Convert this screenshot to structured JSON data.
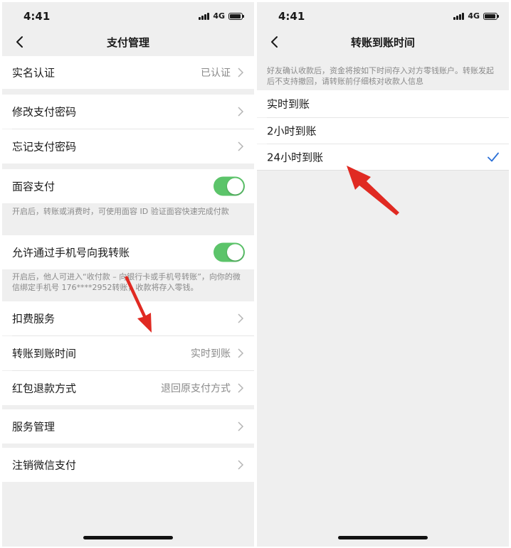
{
  "colors": {
    "page_bg": "#efefef",
    "toggle_on": "#5cc46a",
    "check": "#2c70d7",
    "arrow": "#e02a22"
  },
  "left": {
    "status": {
      "time": "4:41",
      "network": "4G"
    },
    "title": "支付管理",
    "real_name": {
      "label": "实名认证",
      "value": "已认证"
    },
    "change_pwd": {
      "label": "修改支付密码"
    },
    "forget_pwd": {
      "label": "忘记支付密码"
    },
    "face_pay": {
      "label": "面容支付",
      "enabled": true,
      "note": "开启后，转账或消费时，可使用面容 ID 验证面容快速完成付款"
    },
    "phone_transfer": {
      "label": "允许通过手机号向我转账",
      "enabled": true,
      "note": "开启后，他人可进入“收付款 – 向银行卡或手机号转账”，向你的微信绑定手机号 176****2952转账，收款将存入零钱。"
    },
    "deduction": {
      "label": "扣费服务"
    },
    "arrival_time": {
      "label": "转账到账时间",
      "value": "实时到账"
    },
    "refund": {
      "label": "红包退款方式",
      "value": "退回原支付方式"
    },
    "service_mgmt": {
      "label": "服务管理"
    },
    "cancel_pay": {
      "label": "注销微信支付"
    }
  },
  "right": {
    "status": {
      "time": "4:41",
      "network": "4G"
    },
    "title": "转账到账时间",
    "note": "好友确认收款后，资金将按如下时间存入对方零钱账户。转账发起后不支持撤回，请转账前仔细核对收款人信息",
    "options": [
      {
        "label": "实时到账",
        "selected": false
      },
      {
        "label": "2小时到账",
        "selected": false
      },
      {
        "label": "24小时到账",
        "selected": true
      }
    ]
  }
}
